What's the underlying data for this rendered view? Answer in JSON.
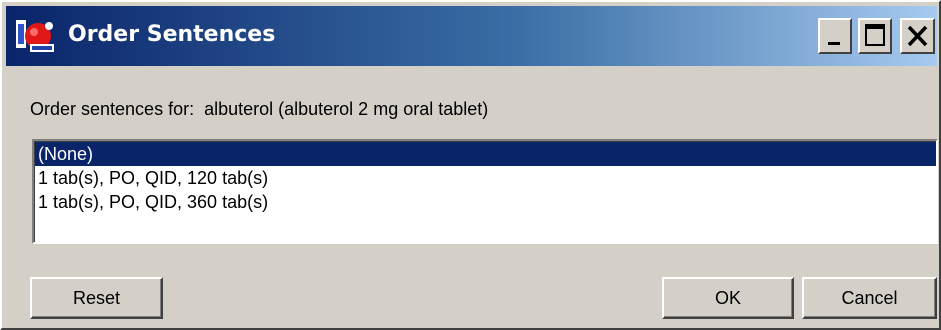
{
  "window": {
    "title": "Order Sentences",
    "app_icon": "medical-app-icon",
    "controls": {
      "minimize_icon": "minimize-icon",
      "maximize_icon": "maximize-icon",
      "close_icon": "close-icon"
    }
  },
  "dialog": {
    "label_prefix": "Order sentences for:",
    "label_drug": "albuterol (albuterol 2 mg oral tablet)",
    "list_items": [
      "(None)",
      "1 tab(s), PO, QID, 120 tab(s)",
      "1 tab(s), PO, QID, 360 tab(s)"
    ],
    "selected_index": 0
  },
  "buttons": {
    "reset": "Reset",
    "ok": "OK",
    "cancel": "Cancel"
  },
  "colors": {
    "title_gradient_start": "#0a246a",
    "title_gradient_end": "#a6caf0",
    "selection": "#0a246a",
    "face": "#d4d0c8"
  }
}
